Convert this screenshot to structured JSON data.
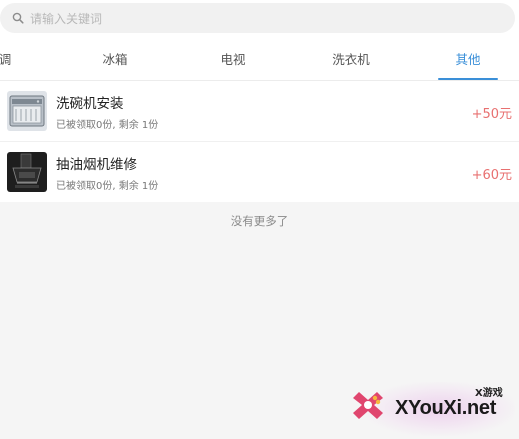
{
  "search": {
    "placeholder": "请输入关键词"
  },
  "tabs": [
    {
      "label": "调",
      "active": false
    },
    {
      "label": "冰箱",
      "active": false
    },
    {
      "label": "电视",
      "active": false
    },
    {
      "label": "洗衣机",
      "active": false
    },
    {
      "label": "其他",
      "active": true
    }
  ],
  "items": [
    {
      "title": "洗碗机安装",
      "subtitle": "已被领取0份, 剩余 1份",
      "reward": "+50元",
      "icon": "dishwasher-image"
    },
    {
      "title": "抽油烟机维修",
      "subtitle": "已被领取0份, 剩余 1份",
      "reward": "+60元",
      "icon": "range-hood-image"
    }
  ],
  "footer": {
    "no_more": "没有更多了"
  },
  "watermark": {
    "small": "X游戏",
    "big": "XYouXi.net"
  },
  "colors": {
    "accent": "#3a8fd8",
    "reward": "#e87070",
    "background": "#f5f5f5"
  }
}
